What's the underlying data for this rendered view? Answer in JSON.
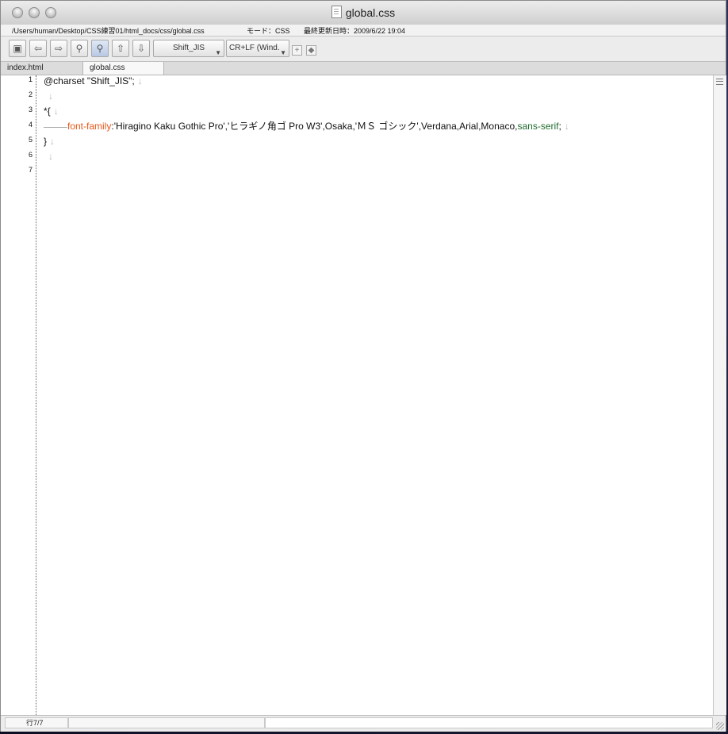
{
  "window": {
    "title": "global.css",
    "path": "/Users/human/Desktop/CSS練習01/html_docs/css/global.css",
    "mode": "モード：CSS",
    "modified": "最終更新日時：2009/6/22 19:04"
  },
  "toolbar": {
    "encoding": "Shift_JIS",
    "line_ending": "CR+LF (Wind.",
    "buttons": [
      "save-icon",
      "undo-icon",
      "redo-icon",
      "find-icon",
      "find-replace-icon",
      "find-up-icon",
      "find-down-icon"
    ]
  },
  "tabs": [
    {
      "label": "index.html",
      "active": false
    },
    {
      "label": "global.css",
      "active": true
    }
  ],
  "editor": {
    "line_numbers": [
      "1",
      "2",
      "3",
      "4",
      "5",
      "6",
      "7"
    ],
    "lines": {
      "l1": "@charset \"Shift_JIS\";",
      "l3": "*{",
      "l4_prop": "font-family",
      "l4_value": ":'Hiragino Kaku Gothic Pro','ヒラギノ角ゴ Pro W3',Osaka,'ＭＳ ゴシック',Verdana,Arial,Monaco,",
      "l4_kw": "sans-serif",
      "l4_end": ";",
      "l5": "}"
    },
    "newline_glyph": "↓"
  },
  "status": {
    "position": "行7/7"
  },
  "colors": {
    "property": "#e4581a",
    "keyword": "#1e6b2c",
    "invisible": "#b7b7b7"
  }
}
